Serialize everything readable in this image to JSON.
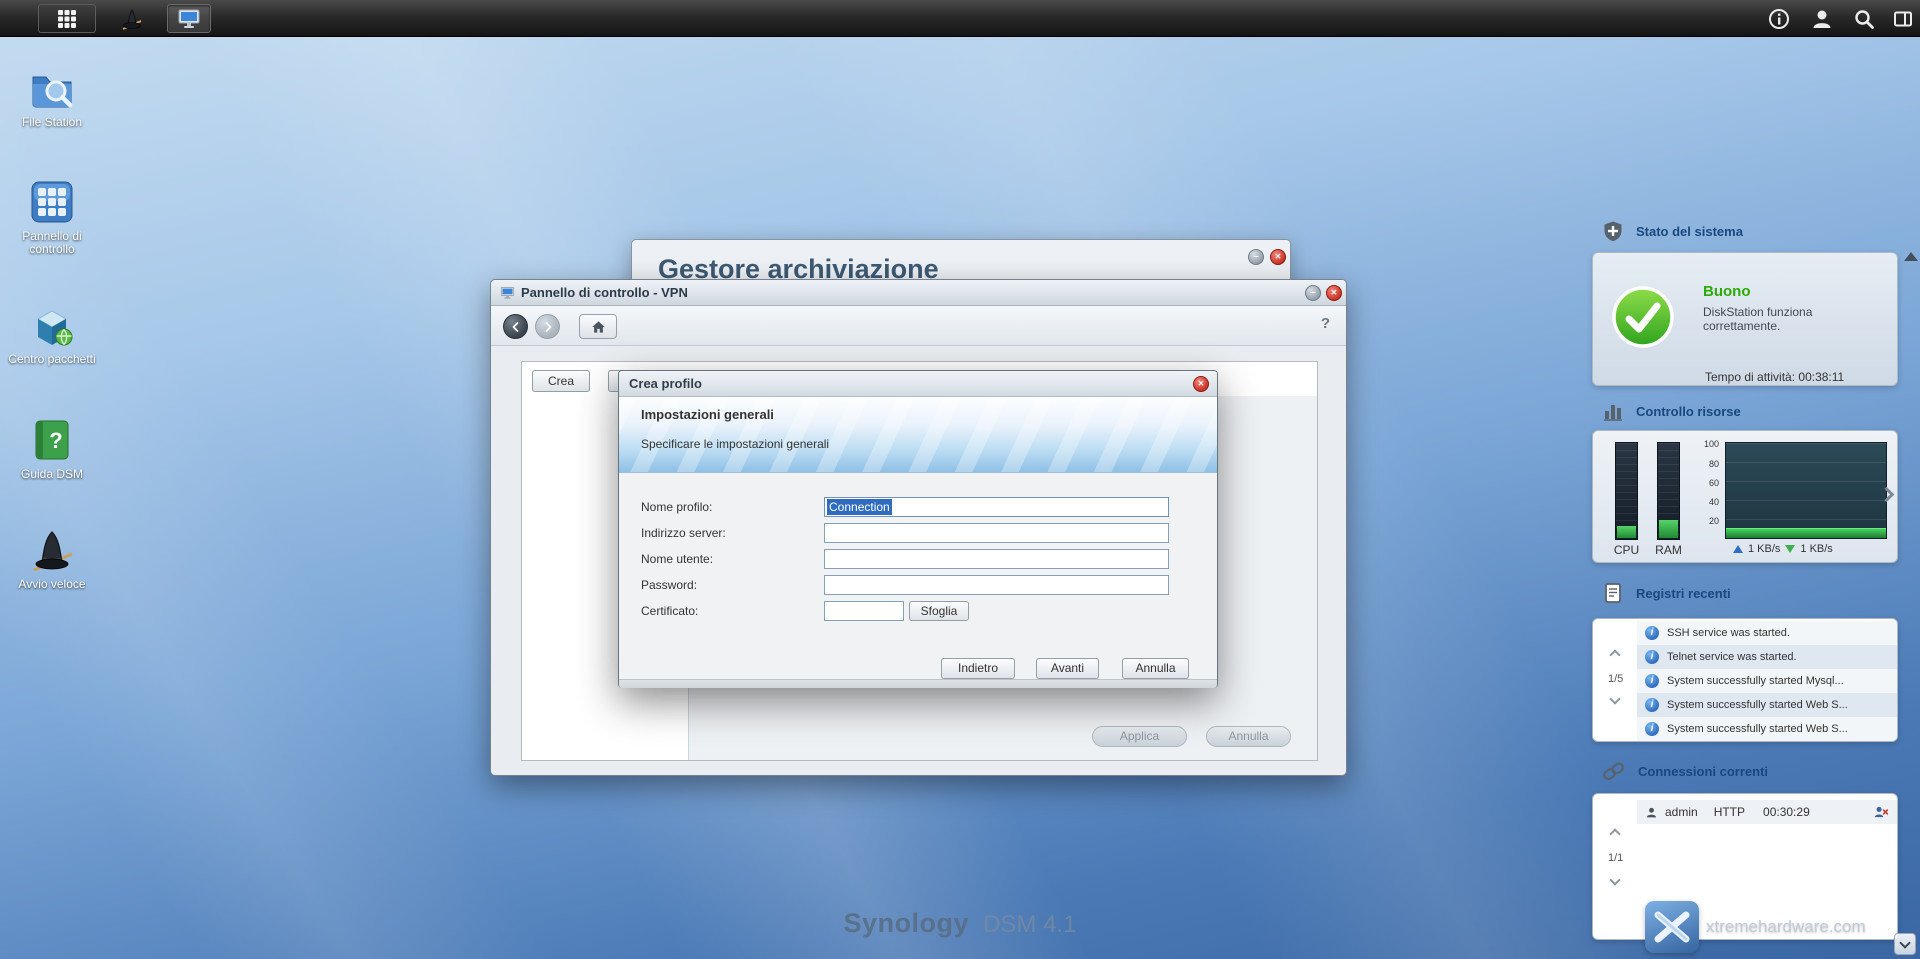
{
  "taskbar": {
    "help_icon": "info",
    "user_icon": "user",
    "search_icon": "search",
    "pilot_icon": "pilot"
  },
  "desktop": {
    "icons": [
      {
        "label": "File Station"
      },
      {
        "label": "Pannello di controllo"
      },
      {
        "label": "Centro pacchetti"
      },
      {
        "label": "Guida DSM"
      },
      {
        "label": "Avvio veloce"
      }
    ]
  },
  "storage_window": {
    "title": "Gestore archiviazione"
  },
  "vpn_window": {
    "title": "Pannello di controllo - VPN",
    "help": "?",
    "crea_button": "Crea",
    "apply_button": "Applica",
    "cancel_button": "Annulla"
  },
  "dialog": {
    "title": "Crea profilo",
    "header_title": "Impostazioni generali",
    "header_subtitle": "Specificare le impostazioni generali",
    "fields": [
      {
        "label": "Nome profilo:",
        "value": "Connection"
      },
      {
        "label": "Indirizzo server:",
        "value": ""
      },
      {
        "label": "Nome utente:",
        "value": ""
      },
      {
        "label": "Password:",
        "value": ""
      },
      {
        "label": "Certificato:",
        "value": ""
      }
    ],
    "browse_button": "Sfoglia",
    "back_button": "Indietro",
    "next_button": "Avanti",
    "cancel_button": "Annulla"
  },
  "widgets": {
    "system_status": {
      "title": "Stato del sistema",
      "status": "Buono",
      "description": "DiskStation funziona correttamente.",
      "uptime_label": "Tempo di attività:",
      "uptime_value": "00:38:11"
    },
    "resources": {
      "title": "Controllo risorse",
      "cpu_label": "CPU",
      "ram_label": "RAM",
      "scale": [
        "100",
        "80",
        "60",
        "40",
        "20"
      ],
      "upload": "1 KB/s",
      "download": "1 KB/s"
    },
    "logs": {
      "title": "Registri recenti",
      "page": "1/5",
      "entries": [
        "SSH service was started.",
        "Telnet service was started.",
        "System successfully started Mysql...",
        "System successfully started Web S...",
        "System successfully started Web S..."
      ]
    },
    "connections": {
      "title": "Connessioni correnti",
      "page": "1/1",
      "user": "admin",
      "protocol": "HTTP",
      "time": "00:30:29"
    }
  },
  "branding": {
    "brand": "Synology",
    "version": "DSM 4.1",
    "watermark": "xtremehardware.com"
  }
}
